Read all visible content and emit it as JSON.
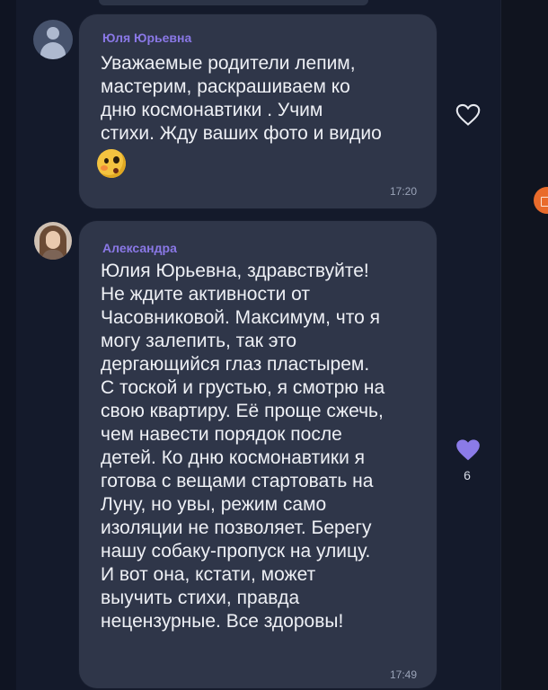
{
  "messages": [
    {
      "author": "Юля Юрьевна",
      "text": "Уважаемые родители лепим,\nмастерим, раскрашиваем ко\nдню космонавтики . Учим\nстихи. Жду ваших фото и видио",
      "emoji": "blushing-face-emoji",
      "time": "17:20",
      "reaction": {
        "icon": "heart-outline-icon"
      }
    },
    {
      "author": "Александра",
      "text": "Юлия Юрьевна, здравствуйте!\nНе ждите активности от\nЧасовниковой. Максимум, что я\nмогу залепить, так это\nдергающийся глаз пластырем.\nС тоской и грустью, я смотрю на\nсвою квартиру. Её проще сжечь,\nчем навести порядок после\nдетей. Ко дню космонавтики я\nготова с вещами стартовать на\nЛуну, но увы, режим само\nизоляции не позволяет. Берегу\nнашу собаку-пропуск на улицу.\nИ вот она, кстати, может\nвыучить стихи, правда\nнецензурные. Все здоровы!",
      "time": "17:49",
      "reaction": {
        "icon": "heart-filled-icon",
        "count": "6",
        "color": "#8b7be8"
      }
    }
  ],
  "colors": {
    "background": "#141a2b",
    "bubble": "#2f3649",
    "author": "#8a78e6",
    "badge": "#e96b2b"
  }
}
